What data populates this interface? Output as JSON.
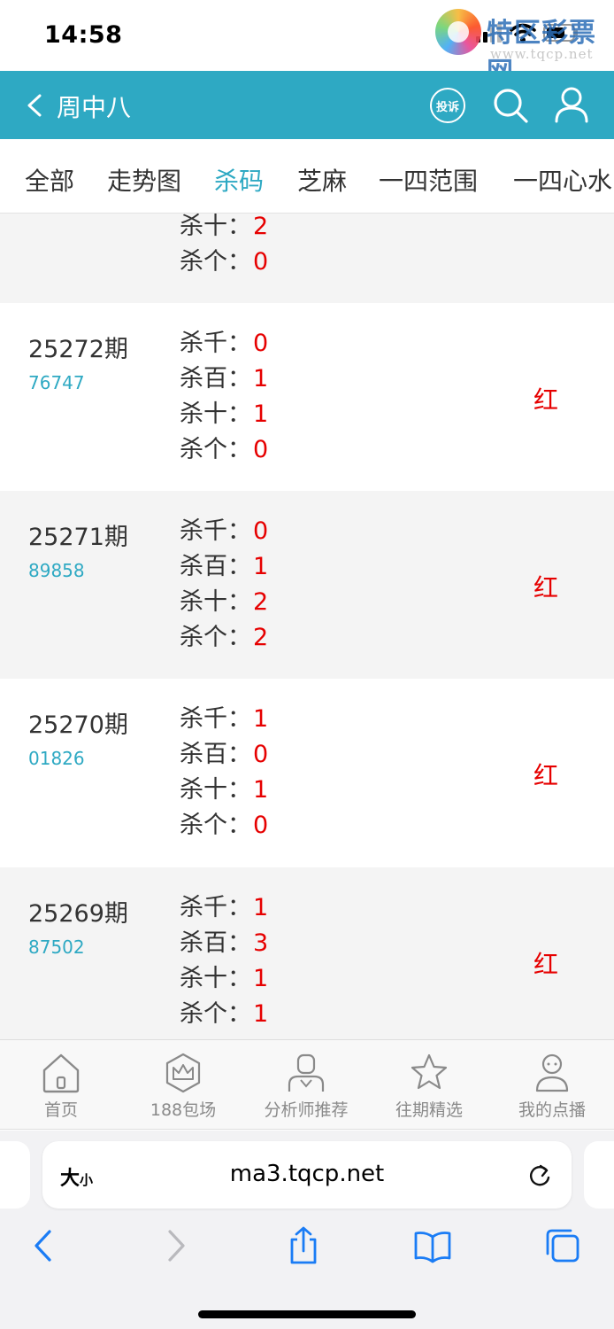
{
  "status_bar": {
    "time": "14:58"
  },
  "watermark": {
    "title": "特区彩票网",
    "url": "www.tqcp.net"
  },
  "header": {
    "back_label": "<",
    "title": "周中八",
    "complaint_label": "投诉"
  },
  "tabs": [
    "全部",
    "走势图",
    "杀码",
    "芝麻",
    "一四范围",
    "一四心水"
  ],
  "active_tab": "杀码",
  "partial_row": {
    "kills": [
      {
        "label": "杀十：",
        "value": "2"
      },
      {
        "label": "杀个：",
        "value": "0"
      }
    ]
  },
  "rows": [
    {
      "issue": "25272期",
      "draw": "76747",
      "result": "红",
      "kills": [
        {
          "label": "杀千：",
          "value": "0"
        },
        {
          "label": "杀百：",
          "value": "1"
        },
        {
          "label": "杀十：",
          "value": "1"
        },
        {
          "label": "杀个：",
          "value": "0"
        }
      ]
    },
    {
      "issue": "25271期",
      "draw": "89858",
      "result": "红",
      "kills": [
        {
          "label": "杀千：",
          "value": "0"
        },
        {
          "label": "杀百：",
          "value": "1"
        },
        {
          "label": "杀十：",
          "value": "2"
        },
        {
          "label": "杀个：",
          "value": "2"
        }
      ]
    },
    {
      "issue": "25270期",
      "draw": "01826",
      "result": "红",
      "kills": [
        {
          "label": "杀千：",
          "value": "1"
        },
        {
          "label": "杀百：",
          "value": "0"
        },
        {
          "label": "杀十：",
          "value": "1"
        },
        {
          "label": "杀个：",
          "value": "0"
        }
      ]
    },
    {
      "issue": "25269期",
      "draw": "87502",
      "result": "红",
      "kills": [
        {
          "label": "杀千：",
          "value": "1"
        },
        {
          "label": "杀百：",
          "value": "3"
        },
        {
          "label": "杀十：",
          "value": "1"
        },
        {
          "label": "杀个：",
          "value": "1"
        }
      ]
    }
  ],
  "bottom_nav": [
    {
      "label": "首页",
      "icon": "home-icon"
    },
    {
      "label": "188包场",
      "icon": "crown-icon"
    },
    {
      "label": "分析师推荐",
      "icon": "analyst-icon"
    },
    {
      "label": "往期精选",
      "icon": "star-icon"
    },
    {
      "label": "我的点播",
      "icon": "profile-icon"
    }
  ],
  "browser": {
    "text_size_big": "大",
    "text_size_small": "小",
    "url": "ma3.tqcp.net"
  },
  "colors": {
    "accent": "#2ea9c3",
    "red": "#e60000",
    "row_gray": "#f4f4f4"
  }
}
